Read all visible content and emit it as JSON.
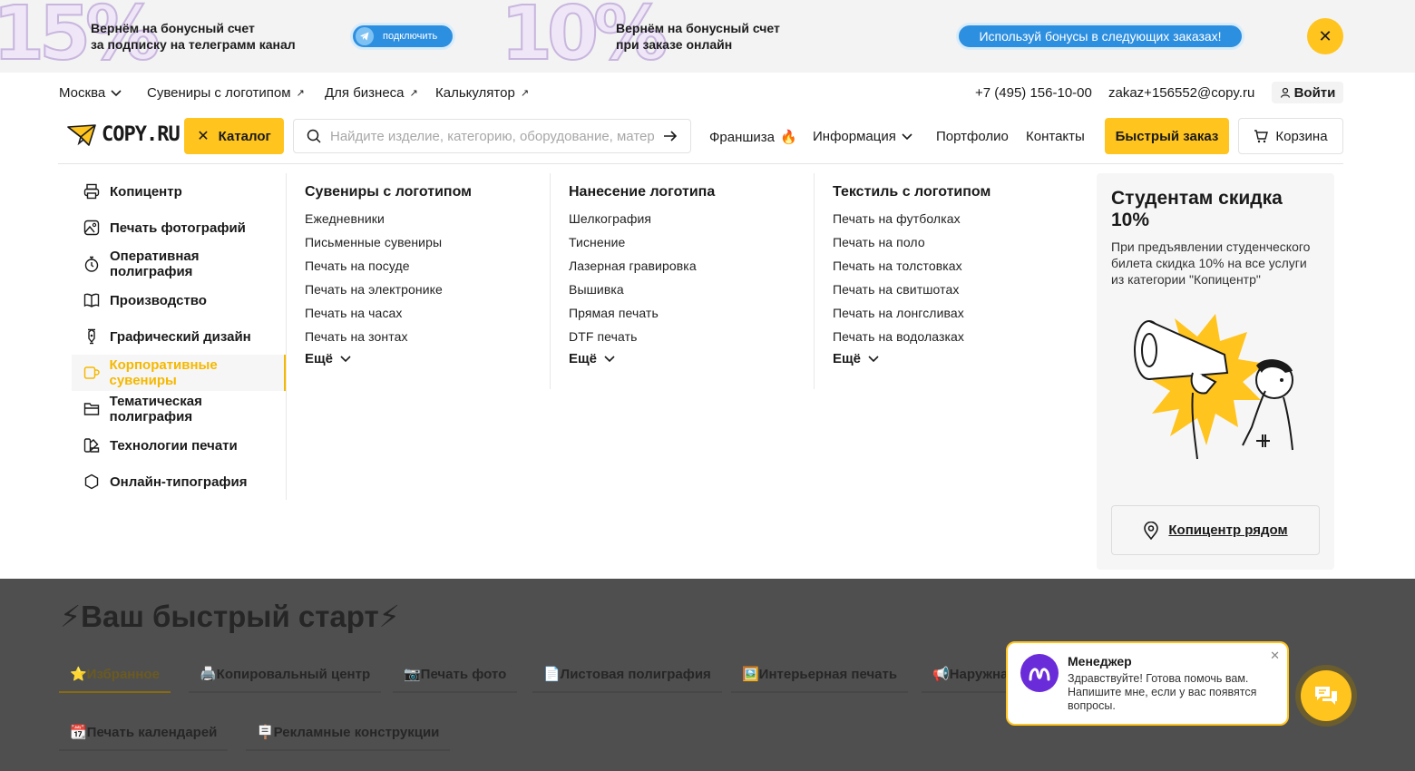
{
  "promo": {
    "left_percent": "15%",
    "left_text_line1": "Вернём на бонусный счет",
    "left_text_line2": "за подписку на телеграмм канал",
    "telegram_button": "подключить",
    "right_percent": "10%",
    "right_text_line1": "Вернём на бонусный счет",
    "right_text_line2": "при заказе онлайн",
    "bonus_button": "Используй бонусы в следующих заказах!"
  },
  "topnav": {
    "city": "Москва",
    "souvenirs": "Сувениры с логотипом",
    "business": "Для бизнеса",
    "calculator": "Калькулятор",
    "phone": "+7 (495) 156-10-00",
    "email": "zakaz+156552@copy.ru",
    "login": "Войти"
  },
  "header": {
    "logo": "COPY.RU",
    "catalog": "Каталог",
    "search_placeholder": "Найдите изделие, категорию, оборудование, материал",
    "franchise": "Франшиза",
    "franchise_emoji": "🔥",
    "info": "Информация",
    "portfolio": "Портфолио",
    "contacts": "Контакты",
    "quick_order": "Быстрый заказ",
    "cart": "Корзина"
  },
  "categories": [
    {
      "label": "Копицентр",
      "icon": "printer-icon"
    },
    {
      "label": "Печать фотографий",
      "icon": "photo-icon"
    },
    {
      "label": "Оперативная полиграфия",
      "icon": "stopwatch-icon"
    },
    {
      "label": "Производство",
      "icon": "book-icon"
    },
    {
      "label": "Графический дизайн",
      "icon": "pen-nib-icon"
    },
    {
      "label": "Корпоративные сувениры",
      "icon": "mug-icon",
      "active": true
    },
    {
      "label": "Тематическая полиграфия",
      "icon": "folder-icon"
    },
    {
      "label": "Технологии печати",
      "icon": "palette-icon"
    },
    {
      "label": "Онлайн-типография",
      "icon": "hexagon-icon"
    }
  ],
  "columns": [
    {
      "title": "Сувениры с логотипом",
      "links": [
        "Ежедневники",
        "Письменные сувениры",
        "Печать на посуде",
        "Печать на электронике",
        "Печать на часах",
        "Печать на зонтах"
      ],
      "more": "Ещё"
    },
    {
      "title": "Нанесение логотипа",
      "links": [
        "Шелкография",
        "Тиснение",
        "Лазерная гравировка",
        "Вышивка",
        "Прямая печать",
        "DTF печать"
      ],
      "more": "Ещё"
    },
    {
      "title": "Текстиль с логотипом",
      "links": [
        "Печать на футболках",
        "Печать на поло",
        "Печать на толстовках",
        "Печать на свитшотах",
        "Печать на лонгсливах",
        "Печать на водолазках"
      ],
      "more": "Ещё"
    }
  ],
  "card": {
    "title": "Студентам скидка 10%",
    "text": "При предъявлении студенческого билета скидка 10% на все услуги из категории \"Копицентр\"",
    "near": "Копицентр рядом"
  },
  "quickstart": {
    "title": "⚡Ваш быстрый старт⚡",
    "tabs_row1": [
      "⭐Избранное",
      "🖨️Копировальный центр",
      "📷Печать фото",
      "📄Листовая полиграфия",
      "🖼️Интерьерная печать",
      "📢Наружная"
    ],
    "tabs_row2": [
      "📆Печать календарей",
      "🪧Рекламные конструкции"
    ]
  },
  "chat": {
    "name": "Менеджер",
    "message": "Здравствуйте! Готова помочь вам. Напишите мне, если у вас появятся вопросы."
  },
  "colors": {
    "accent": "#ffc41e",
    "blue": "#2d8fe0",
    "overlay": "#4f4f4f"
  }
}
